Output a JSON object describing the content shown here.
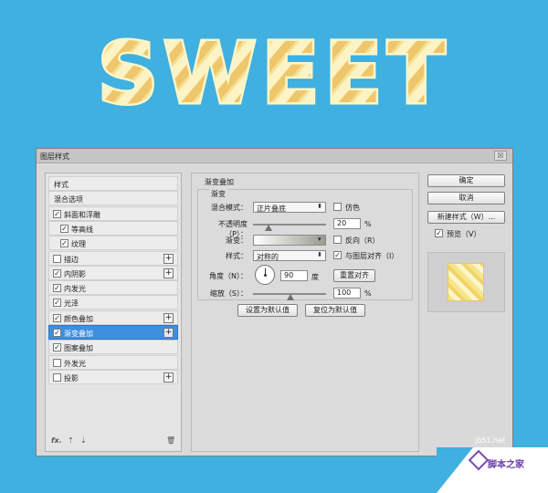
{
  "title_art": {
    "text": "SWEET"
  },
  "dialog": {
    "title": "图层样式",
    "close_label": "☒",
    "left_list": {
      "items": [
        {
          "label": "样式",
          "check": null,
          "plus": false,
          "selected": false,
          "sub": false
        },
        {
          "label": "混合选项",
          "check": null,
          "plus": false,
          "selected": false,
          "sub": false
        },
        {
          "label": "斜面和浮雕",
          "check": true,
          "plus": false,
          "selected": false,
          "sub": false
        },
        {
          "label": "等高线",
          "check": true,
          "plus": false,
          "selected": false,
          "sub": true
        },
        {
          "label": "纹理",
          "check": true,
          "plus": false,
          "selected": false,
          "sub": true
        },
        {
          "label": "描边",
          "check": false,
          "plus": true,
          "selected": false,
          "sub": false
        },
        {
          "label": "内阴影",
          "check": true,
          "plus": true,
          "selected": false,
          "sub": false
        },
        {
          "label": "内发光",
          "check": true,
          "plus": false,
          "selected": false,
          "sub": false
        },
        {
          "label": "光泽",
          "check": true,
          "plus": false,
          "selected": false,
          "sub": false
        },
        {
          "label": "颜色叠加",
          "check": true,
          "plus": true,
          "selected": false,
          "sub": false
        },
        {
          "label": "渐变叠加",
          "check": true,
          "plus": true,
          "selected": true,
          "sub": false
        },
        {
          "label": "图案叠加",
          "check": true,
          "plus": false,
          "selected": false,
          "sub": false
        },
        {
          "label": "外发光",
          "check": false,
          "plus": false,
          "selected": false,
          "sub": false
        },
        {
          "label": "投影",
          "check": false,
          "plus": true,
          "selected": false,
          "sub": false
        }
      ],
      "footer": {
        "fx": "fx.",
        "up": "⇡",
        "down": "⇣",
        "trash": "🗑"
      }
    },
    "settings": {
      "section_title": "渐变叠加",
      "group_title": "渐变",
      "blend_mode_label": "混合模式：",
      "blend_mode_value": "正片叠底",
      "dither_label": "仿色",
      "dither_checked": false,
      "opacity_label": "不透明度（P）：",
      "opacity_value": "20",
      "opacity_unit": "%",
      "gradient_label": "渐变：",
      "reverse_label": "反向（R）",
      "reverse_checked": false,
      "style_label": "样式：",
      "style_value": "对称的",
      "align_label": "与图层对齐（I）",
      "align_checked": true,
      "angle_label": "角度（N）：",
      "angle_value": "90",
      "angle_unit": "度",
      "reset_align_label": "重置对齐",
      "scale_label": "缩放（S）：",
      "scale_value": "100",
      "scale_unit": "%",
      "set_default_label": "设置为默认值",
      "reset_default_label": "复位为默认值"
    },
    "right": {
      "ok_label": "确定",
      "cancel_label": "取消",
      "new_style_label": "新建样式（W）...",
      "preview_label": "预览（V）",
      "preview_checked": true
    }
  },
  "watermark": {
    "url": "jb51.net",
    "site": "脚本之家"
  },
  "colors": {
    "background": "#3fb0e0",
    "selection": "#3d8fe0",
    "candy_yellow": "#f6e68a"
  }
}
